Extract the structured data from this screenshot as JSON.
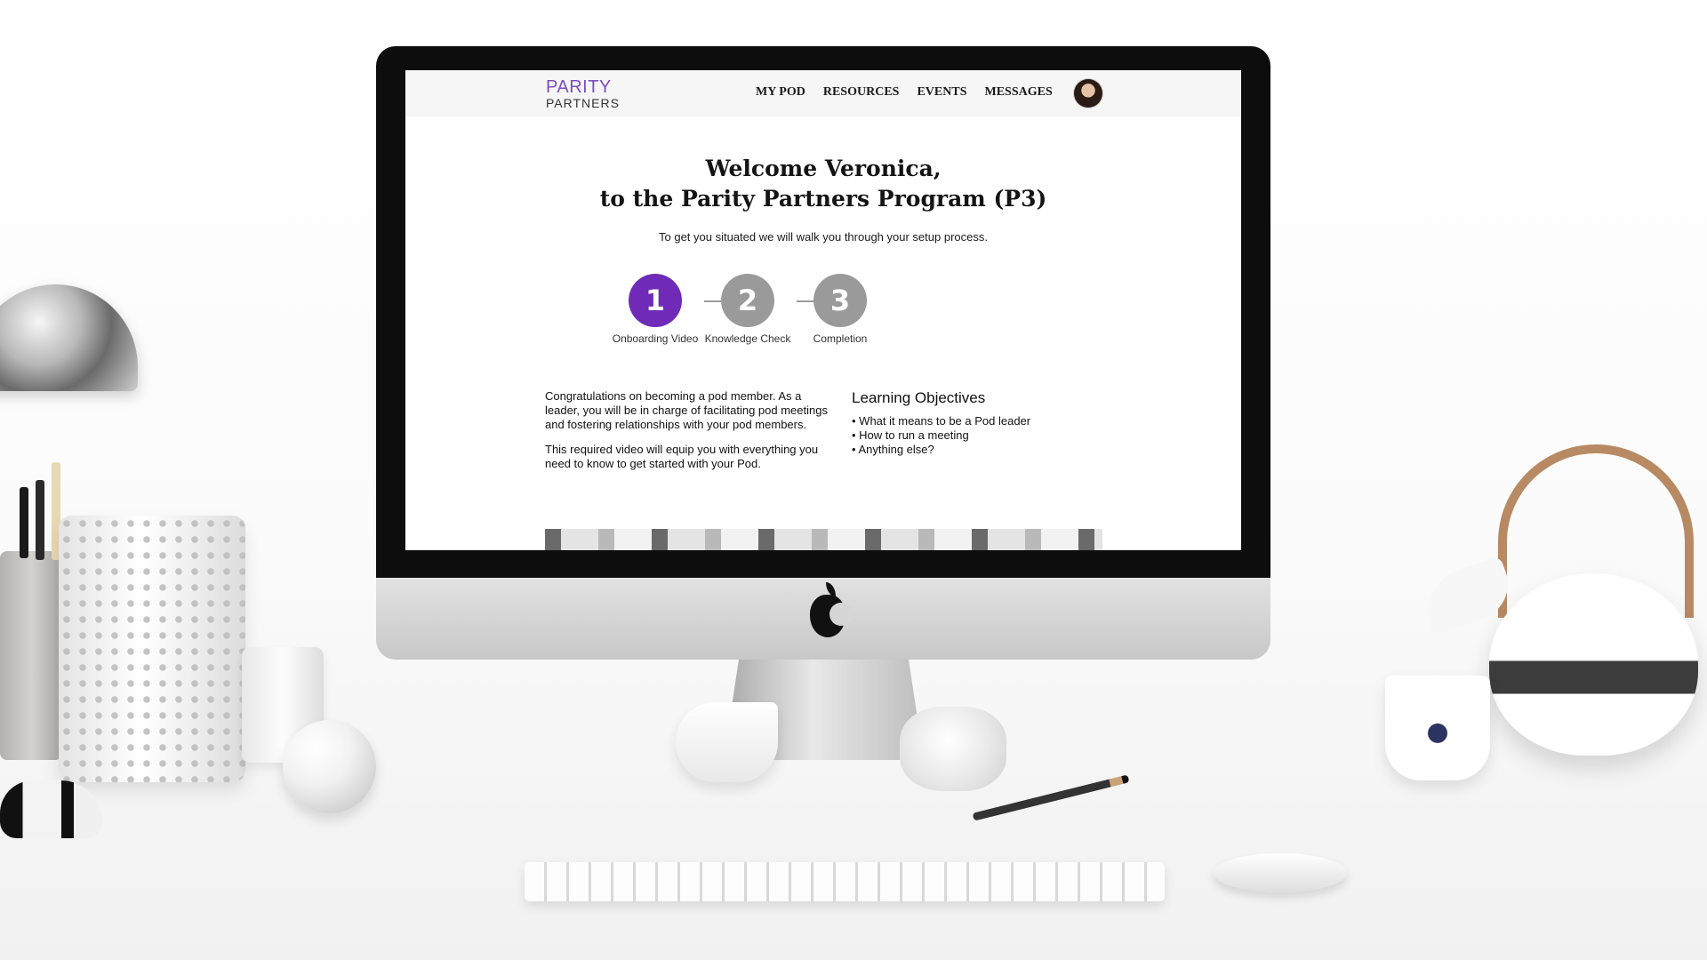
{
  "site": {
    "logo": {
      "line1": "PARITY",
      "line2": "PARTNERS"
    },
    "nav": [
      "MY POD",
      "RESOURCES",
      "EVENTS",
      "MESSAGES"
    ]
  },
  "welcome": {
    "line1": "Welcome Veronica,",
    "line2": "to the Parity Partners Program (P3)"
  },
  "intro": "To get you situated we will walk you through your setup process.",
  "steps": [
    {
      "number": "1",
      "label": "Onboarding Video",
      "state": "active"
    },
    {
      "number": "2",
      "label": "Knowledge Check",
      "state": "inactive"
    },
    {
      "number": "3",
      "label": "Completion",
      "state": "inactive"
    }
  ],
  "content": {
    "paragraph1": "Congratulations on becoming a pod member. As a leader, you will be in charge of facilitating pod meetings and fostering relationships with your pod members.",
    "paragraph2": "This required video will equip you with everything you need to know to get started with your Pod."
  },
  "objectives": {
    "title": "Learning Objectives",
    "items": [
      "What it means to be a Pod leader",
      "How to run a meeting",
      "Anything else?"
    ]
  },
  "colors": {
    "brand_purple": "#6f2bb8",
    "logo_purple": "#7b4fc1",
    "step_inactive": "#9a9a9a"
  },
  "icons": [
    "user-avatar-icon",
    "apple-logo-icon"
  ]
}
